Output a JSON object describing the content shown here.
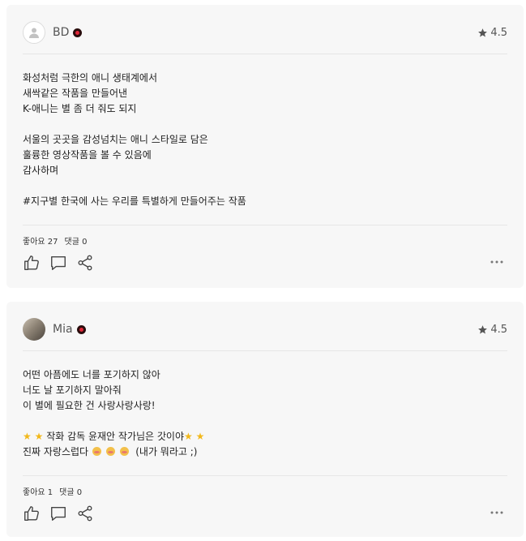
{
  "reviews": [
    {
      "username": "BD",
      "rating": "4.5",
      "lines": [
        "화성처럼 극한의 애니 생태계에서",
        "새싹같은 작품을 만들어낸",
        "K-애니는 별 좀 더 줘도 되지",
        "",
        "서울의 곳곳을 감성넘치는 애니 스타일로 담은",
        "훌륭한 영상작품을 볼 수 있음에",
        "감사하며",
        "",
        "#지구별 한국에 사는 우리를 특별하게 만들어주는 작품"
      ],
      "likes": "좋아요 27",
      "comments": "댓글 0"
    },
    {
      "username": "Mia",
      "rating": "4.5",
      "lines": [
        "어떤 아픔에도 너를 포기하지 않아",
        "너도 날 포기하지 말아줘",
        "이 별에 필요한 건 사랑사랑사랑!",
        ""
      ],
      "line5_text": "작화 감독 윤재안 작가님은 갓이야",
      "line6_text": "진짜 자랑스럽다",
      "line6_suffix": "(내가 뭐라고 ;)",
      "likes": "좋아요 1",
      "comments": "댓글 0"
    }
  ],
  "colors": {
    "card_bg": "#f7f7f7",
    "badge": "#e0283a",
    "star_emoji": "#f2b81a"
  },
  "icons": [
    "user-icon",
    "star-icon",
    "like-icon",
    "comment-icon",
    "share-icon",
    "more-icon"
  ]
}
